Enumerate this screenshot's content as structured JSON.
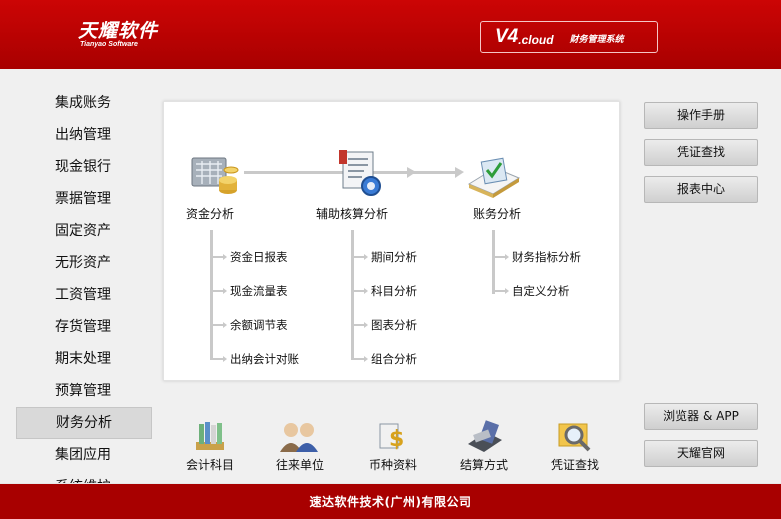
{
  "brand": {
    "logo_text": "天耀软件",
    "logo_sub": "Tianyao Software"
  },
  "version": {
    "name": "V4",
    "edition": ".cloud",
    "system_title": "财务管理系统"
  },
  "sidebar": {
    "items": [
      {
        "label": "集成账务"
      },
      {
        "label": "出纳管理"
      },
      {
        "label": "现金银行"
      },
      {
        "label": "票据管理"
      },
      {
        "label": "固定资产"
      },
      {
        "label": "无形资产"
      },
      {
        "label": "工资管理"
      },
      {
        "label": "存货管理"
      },
      {
        "label": "期末处理"
      },
      {
        "label": "预算管理"
      },
      {
        "label": "财务分析"
      },
      {
        "label": "集团应用"
      },
      {
        "label": "系统维护"
      }
    ],
    "active_label": "财务分析"
  },
  "panel": {
    "modules": [
      {
        "label": "资金分析",
        "icon": "fund-analysis-icon",
        "children": [
          "资金日报表",
          "现金流量表",
          "余额调节表",
          "出纳会计对账"
        ]
      },
      {
        "label": "辅助核算分析",
        "icon": "auxiliary-accounting-icon",
        "children": [
          "期间分析",
          "科目分析",
          "图表分析",
          "组合分析"
        ]
      },
      {
        "label": "账务分析",
        "icon": "accounts-analysis-icon",
        "children": [
          "财务指标分析",
          "自定义分析"
        ]
      }
    ]
  },
  "right_buttons": {
    "top": [
      "操作手册",
      "凭证查找",
      "报表中心"
    ],
    "bottom": [
      "浏览器 & APP",
      "天耀官网"
    ]
  },
  "toolbar": [
    {
      "label": "会计科目",
      "icon": "account-subjects-icon"
    },
    {
      "label": "往来单位",
      "icon": "contacts-icon"
    },
    {
      "label": "币种资料",
      "icon": "currency-icon"
    },
    {
      "label": "结算方式",
      "icon": "settlement-icon"
    },
    {
      "label": "凭证查找",
      "icon": "voucher-search-icon"
    }
  ],
  "footer": {
    "company": "速达软件技术(广州)有限公司"
  },
  "colors": {
    "header": "#c00000",
    "footer": "#a80000",
    "background": "#f0f0f0"
  }
}
